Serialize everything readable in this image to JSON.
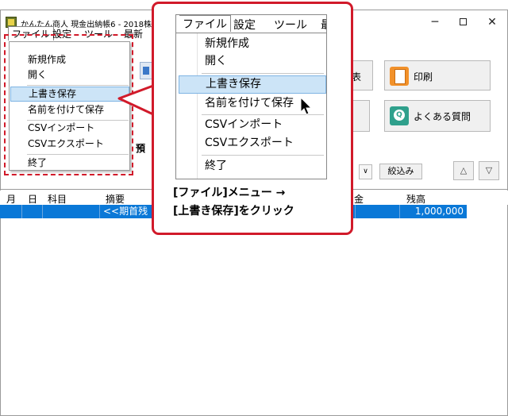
{
  "window": {
    "title": "かんたん商人 現金出納帳6 - 2018株式会",
    "min": "─",
    "close": "✕"
  },
  "menubar": {
    "file": "ファイル",
    "settings": "設定",
    "tools": "ツール",
    "recent": "最新"
  },
  "file_menu": {
    "items": [
      "新規作成",
      "開く",
      "上書き保存",
      "名前を付けて保存",
      "CSVインポート",
      "CSVエクスポート",
      "終了"
    ]
  },
  "toolbar": {
    "print": "印刷",
    "faq": "よくある質問",
    "filter": "絞込み",
    "up": "△",
    "down": "▽",
    "select_arrow": "∨",
    "partial_label": "預",
    "partial_right": "表"
  },
  "ledger": {
    "columns": [
      "月",
      "日",
      "科目",
      "摘要",
      "金",
      "残高"
    ],
    "row": {
      "summary": "<<期首残",
      "balance": "1,000,000"
    }
  },
  "callout": {
    "zoom_menubar": {
      "file": "ファイル",
      "settings": "設定",
      "tools": "ツール",
      "recent": "最"
    },
    "zoom_items": [
      "新規作成",
      "開く",
      "上書き保存",
      "名前を付けて保存",
      "CSVインポート",
      "CSVエクスポート",
      "終了"
    ],
    "caption_line1": "[ファイル]メニュー →",
    "caption_line2": "[上書き保存]をクリック",
    "highlight_color": "#cce4f7",
    "frame_color": "#d11a2a"
  }
}
